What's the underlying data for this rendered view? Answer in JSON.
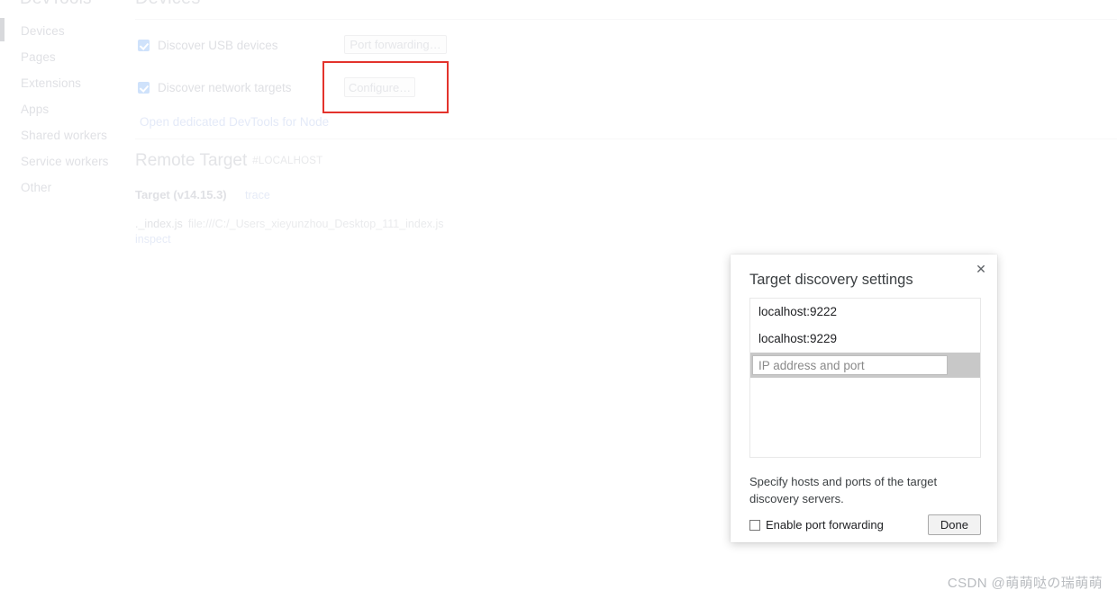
{
  "sidebar": {
    "title": "DevTools",
    "items": [
      {
        "label": "Devices",
        "selected": true
      },
      {
        "label": "Pages",
        "selected": false
      },
      {
        "label": "Extensions",
        "selected": false
      },
      {
        "label": "Apps",
        "selected": false
      },
      {
        "label": "Shared workers",
        "selected": false
      },
      {
        "label": "Service workers",
        "selected": false
      },
      {
        "label": "Other",
        "selected": false
      }
    ]
  },
  "content": {
    "heading": "Devices",
    "discover_usb": {
      "label": "Discover USB devices",
      "checked": true
    },
    "discover_network": {
      "label": "Discover network targets",
      "checked": true
    },
    "port_forwarding_button": "Port forwarding…",
    "configure_button": "Configure…",
    "node_link": "Open dedicated DevTools for Node",
    "remote_target": {
      "heading": "Remote Target",
      "anchor": "#LOCALHOST",
      "target_version": "Target (v14.15.3)",
      "trace_link": "trace",
      "file_name": "._index.js",
      "file_url": "file:///C:/_Users_xieyunzhou_Desktop_111_index.js",
      "inspect_link": "inspect"
    }
  },
  "dialog": {
    "title": "Target discovery settings",
    "close_icon": "close-icon",
    "close_glyph": "✕",
    "hosts": [
      "localhost:9222",
      "localhost:9229"
    ],
    "new_host_placeholder": "IP address and port",
    "new_host_value": "",
    "help_text": "Specify hosts and ports of the target discovery servers.",
    "enable_port_forwarding_label": "Enable port forwarding",
    "enable_port_forwarding_checked": false,
    "done_button": "Done"
  },
  "watermark": "CSDN @萌萌哒の瑞萌萌",
  "colors": {
    "highlight_red": "#e3332c",
    "checkbox_blue": "#cfe2fb",
    "dialog_text": "#202124",
    "faded_text": "#e0e1e5"
  }
}
